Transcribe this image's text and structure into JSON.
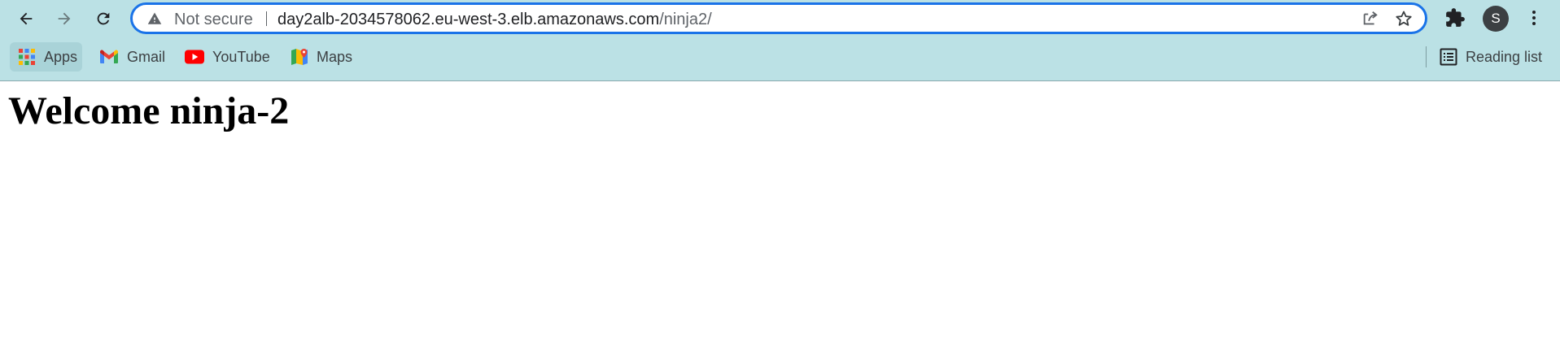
{
  "browser": {
    "toolbar": {
      "back_icon": "arrow-left-icon",
      "forward_icon": "arrow-right-icon",
      "reload_icon": "reload-icon"
    },
    "omnibox": {
      "security_label": "Not secure",
      "url_host": "day2alb-2034578062.eu-west-3.elb.amazonaws.com",
      "url_path": "/ninja2/",
      "focus_color": "#1a73e8"
    },
    "profile_initial": "S",
    "bookmarks": {
      "items": [
        {
          "label": "Apps",
          "icon": "apps-grid-icon"
        },
        {
          "label": "Gmail",
          "icon": "gmail-icon"
        },
        {
          "label": "YouTube",
          "icon": "youtube-icon"
        },
        {
          "label": "Maps",
          "icon": "maps-icon"
        }
      ],
      "reading_list_label": "Reading list"
    },
    "theme_color": "#bbe1e5"
  },
  "page": {
    "heading": "Welcome ninja-2"
  }
}
